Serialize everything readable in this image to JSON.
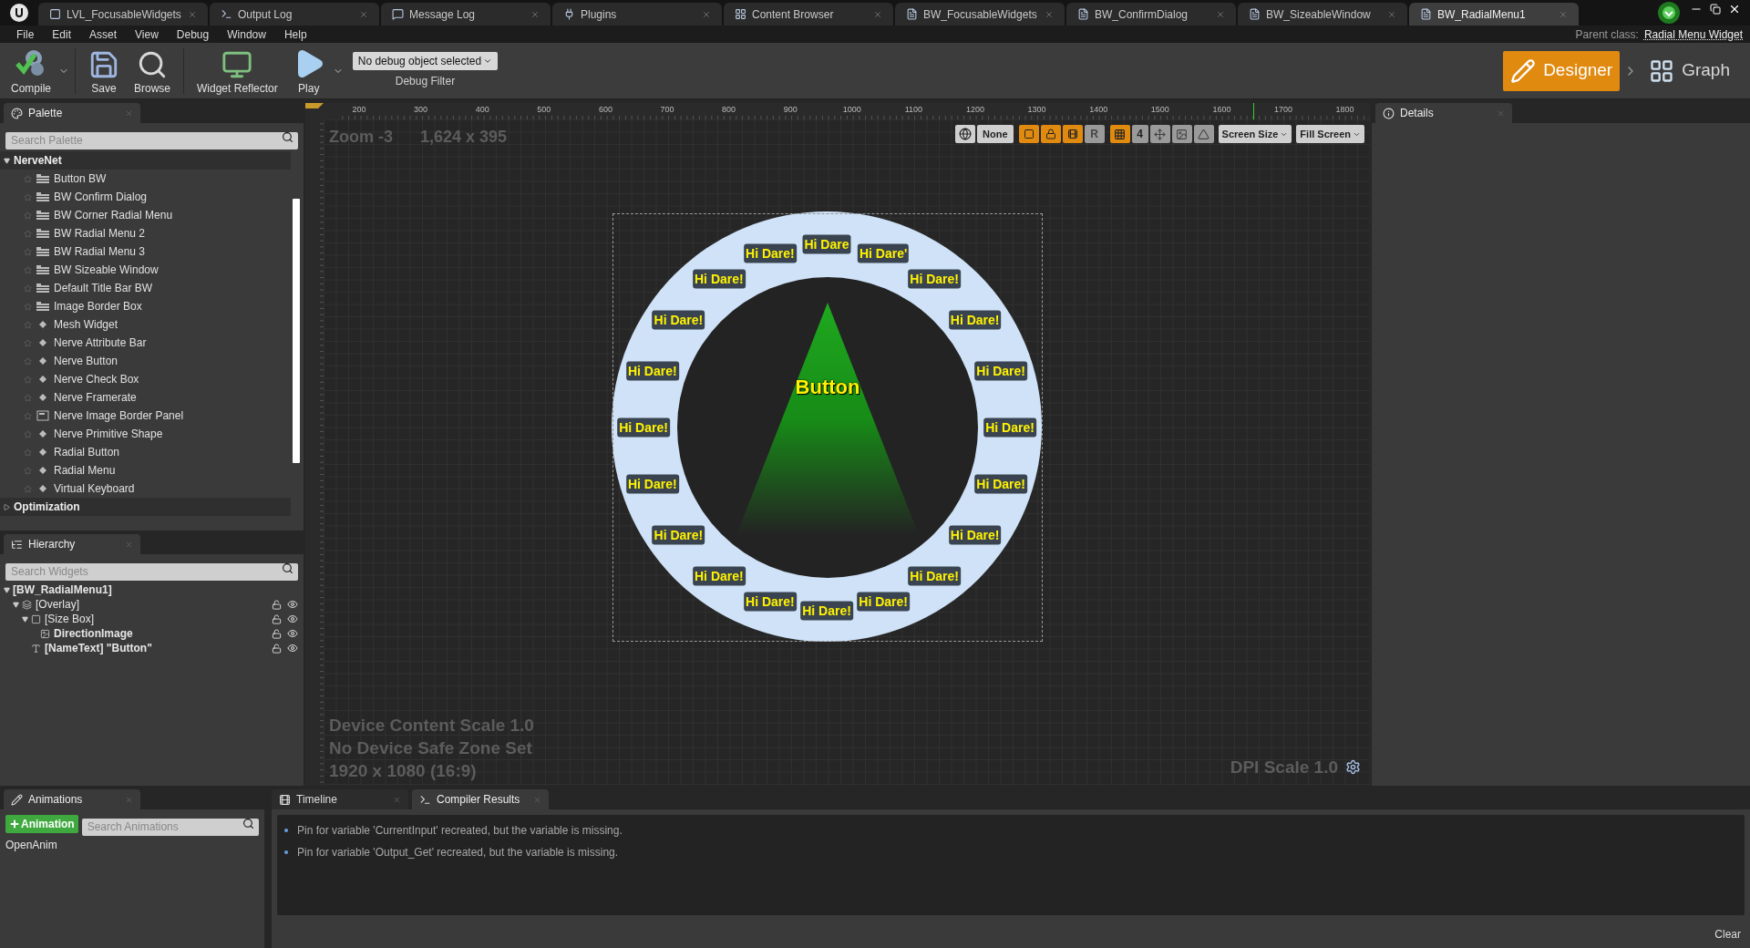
{
  "tabs": [
    {
      "label": "LVL_FocusableWidgets",
      "kind": "level",
      "selected": false
    },
    {
      "label": "Output Log",
      "kind": "log",
      "selected": false
    },
    {
      "label": "Message Log",
      "kind": "message",
      "selected": false
    },
    {
      "label": "Plugins",
      "kind": "plugin",
      "selected": false
    },
    {
      "label": "Content Browser",
      "kind": "browser",
      "selected": false
    },
    {
      "label": "BW_FocusableWidgets",
      "kind": "widget",
      "selected": false
    },
    {
      "label": "BW_ConfirmDialog",
      "kind": "widget",
      "selected": false
    },
    {
      "label": "BW_SizeableWindow",
      "kind": "widget",
      "selected": false
    },
    {
      "label": "BW_RadialMenu1",
      "kind": "widget",
      "selected": true
    }
  ],
  "menu": [
    "File",
    "Edit",
    "Asset",
    "View",
    "Debug",
    "Window",
    "Help"
  ],
  "parent_class": {
    "label": "Parent class:",
    "value": "Radial Menu Widget"
  },
  "toolbar": {
    "buttons": [
      {
        "label": "Compile",
        "kind": "compile",
        "dropdown": true
      },
      {
        "label": "Save",
        "kind": "save",
        "dropdown": false
      },
      {
        "label": "Browse",
        "kind": "browse",
        "dropdown": false
      },
      {
        "label": "Widget Reflector",
        "kind": "reflector",
        "dropdown": false
      },
      {
        "label": "Play",
        "kind": "play",
        "dropdown": true
      }
    ],
    "debug_filter": {
      "value": "No debug object selected",
      "label": "Debug Filter"
    }
  },
  "modes": [
    {
      "label": "Designer",
      "selected": true
    },
    {
      "label": "Graph",
      "selected": false
    }
  ],
  "palette": {
    "title": "Palette",
    "placeholder": "Search Palette",
    "categories": [
      {
        "name": "NerveNet",
        "expanded": true,
        "items": [
          {
            "label": "Button BW",
            "kind": "blueprint"
          },
          {
            "label": "BW Confirm Dialog",
            "kind": "blueprint"
          },
          {
            "label": "BW Corner Radial Menu",
            "kind": "blueprint"
          },
          {
            "label": "BW Radial Menu 2",
            "kind": "blueprint"
          },
          {
            "label": "BW Radial Menu 3",
            "kind": "blueprint"
          },
          {
            "label": "BW Sizeable Window",
            "kind": "blueprint"
          },
          {
            "label": "Default Title Bar BW",
            "kind": "blueprint"
          },
          {
            "label": "Image Border Box",
            "kind": "blueprint"
          },
          {
            "label": "Mesh Widget",
            "kind": "native"
          },
          {
            "label": "Nerve Attribute Bar",
            "kind": "native"
          },
          {
            "label": "Nerve Button",
            "kind": "native"
          },
          {
            "label": "Nerve Check Box",
            "kind": "native"
          },
          {
            "label": "Nerve Framerate",
            "kind": "native"
          },
          {
            "label": "Nerve Image Border Panel",
            "kind": "panel"
          },
          {
            "label": "Nerve Primitive Shape",
            "kind": "native"
          },
          {
            "label": "Radial Button",
            "kind": "native"
          },
          {
            "label": "Radial Menu",
            "kind": "native"
          },
          {
            "label": "Virtual Keyboard",
            "kind": "native"
          }
        ]
      },
      {
        "name": "Optimization",
        "expanded": false
      }
    ]
  },
  "hierarchy": {
    "title": "Hierarchy",
    "placeholder": "Search Widgets",
    "tree": [
      {
        "label": "[BW_RadialMenu1]",
        "bold": true,
        "expanded": true,
        "children": [
          {
            "label": "[Overlay]",
            "bold": false,
            "kind": "overlay",
            "expanded": true,
            "children": [
              {
                "label": "[Size Box]",
                "bold": false,
                "kind": "sizebox",
                "expanded": true,
                "children": [
                  {
                    "label": "DirectionImage",
                    "bold": true,
                    "kind": "image"
                  }
                ]
              },
              {
                "label": "[NameText] \"Button\"",
                "bold": true,
                "kind": "text"
              }
            ]
          }
        ]
      }
    ]
  },
  "canvas": {
    "zoom": "Zoom -3",
    "size": "1,624 x 395",
    "ruler": [
      "200",
      "300",
      "400",
      "500",
      "600",
      "700",
      "800",
      "900",
      "1000",
      "1100",
      "1200",
      "1300",
      "1400",
      "1500",
      "1600",
      "1700",
      "1800"
    ],
    "toolbar": {
      "locale": "None",
      "toggles": [
        {
          "on": true
        },
        {
          "on": true
        },
        {
          "on": true
        },
        {
          "label": "R",
          "on": false
        }
      ],
      "grid": {
        "on": true,
        "value": "4"
      },
      "tools": [
        {
          "on": false
        },
        {
          "on": false
        },
        {
          "on": false
        }
      ],
      "dropdowns": [
        "Screen Size",
        "Fill Screen"
      ]
    },
    "center_label": "Button",
    "ring_labels": [
      "Hi Dare",
      "Hi Dare!",
      "Hi Dare'",
      "Hi Dare!",
      "Hi Dare!",
      "Hi Dare!",
      "Hi Dare!",
      "Hi Dare!",
      "Hi Dare!",
      "Hi Dare!",
      "Hi Dare!",
      "Hi Dare!",
      "Hi Dare!",
      "Hi Dare!",
      "Hi Dare!",
      "Hi Dare!",
      "Hi Dare!",
      "Hi Dare!",
      "Hi Dare!",
      "Hi Dare!"
    ],
    "info": [
      "Device Content Scale 1.0",
      "No Device Safe Zone Set",
      "1920 x 1080 (16:9)"
    ],
    "dpi": "DPI Scale 1.0"
  },
  "details": {
    "title": "Details"
  },
  "animations": {
    "title": "Animations",
    "add": "Animation",
    "placeholder": "Search Animations",
    "items": [
      "OpenAnim"
    ]
  },
  "bottom_tabs": [
    {
      "label": "Timeline",
      "selected": false
    },
    {
      "label": "Compiler Results",
      "selected": true
    }
  ],
  "messages": [
    "Pin for variable 'CurrentInput' recreated, but the variable is missing.",
    "Pin for variable 'Output_Get' recreated, but the variable is missing."
  ],
  "clear": "Clear"
}
